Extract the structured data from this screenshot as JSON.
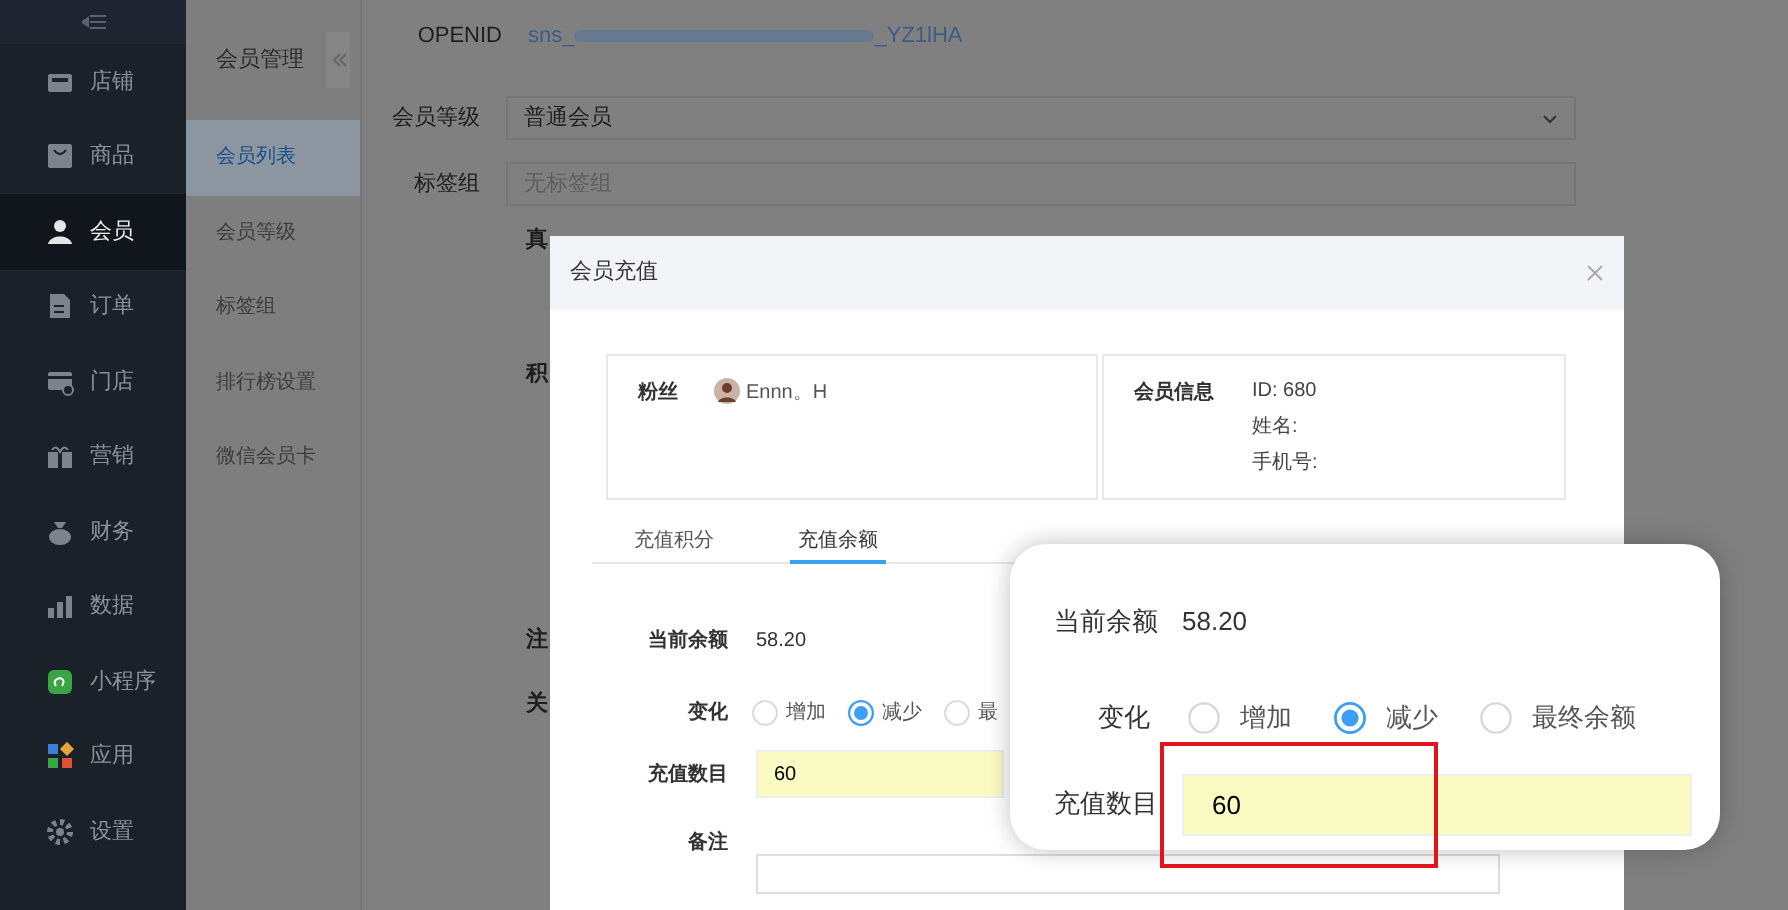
{
  "sidebar": {
    "items": [
      {
        "label": "店铺",
        "selected": false
      },
      {
        "label": "商品",
        "selected": false
      },
      {
        "label": "会员",
        "selected": true
      },
      {
        "label": "订单",
        "selected": false
      },
      {
        "label": "门店",
        "selected": false
      },
      {
        "label": "营销",
        "selected": false
      },
      {
        "label": "财务",
        "selected": false
      },
      {
        "label": "数据",
        "selected": false
      },
      {
        "label": "小程序",
        "selected": false
      },
      {
        "label": "应用",
        "selected": false
      },
      {
        "label": "设置",
        "selected": false
      }
    ]
  },
  "submenu": {
    "title": "会员管理",
    "items": [
      {
        "label": "会员列表",
        "selected": true
      },
      {
        "label": "会员等级",
        "selected": false
      },
      {
        "label": "标签组",
        "selected": false
      },
      {
        "label": "排行榜设置",
        "selected": false
      },
      {
        "label": "微信会员卡",
        "selected": false
      }
    ]
  },
  "member_form": {
    "openid": {
      "label": "OPENID",
      "value_start": "sns_",
      "value_end": "_YZ1lHA"
    },
    "level": {
      "label": "会员等级",
      "value": "普通会员"
    },
    "tags": {
      "label": "标签组",
      "placeholder": "无标签组"
    },
    "cut_labels": [
      "真",
      "积",
      "注",
      "关"
    ]
  },
  "dialog": {
    "title": "会员充值",
    "fan": {
      "label": "粉丝",
      "name": "Ennn。H"
    },
    "member_info": {
      "label": "会员信息",
      "lines": [
        "ID: 680",
        "姓名:",
        "手机号:"
      ]
    },
    "tabs": [
      {
        "label": "充值积分",
        "selected": false
      },
      {
        "label": "充值余额",
        "selected": true
      }
    ],
    "balance": {
      "label": "当前余额",
      "value": "58.20"
    },
    "change": {
      "label": "变化",
      "options": [
        {
          "label": "增加",
          "selected": false
        },
        {
          "label": "减少",
          "selected": true
        },
        {
          "label": "最",
          "selected": false
        }
      ]
    },
    "amount": {
      "label": "充值数目",
      "value": "60"
    },
    "note": {
      "label": "备注"
    }
  },
  "zoom_callout": {
    "balance": {
      "label": "当前余额",
      "value": "58.20"
    },
    "change": {
      "label": "变化",
      "options": [
        {
          "label": "增加",
          "selected": false
        },
        {
          "label": "减少",
          "selected": true
        },
        {
          "label": "最终余额",
          "selected": false
        }
      ]
    },
    "amount": {
      "label": "充值数目",
      "value": "60"
    }
  }
}
